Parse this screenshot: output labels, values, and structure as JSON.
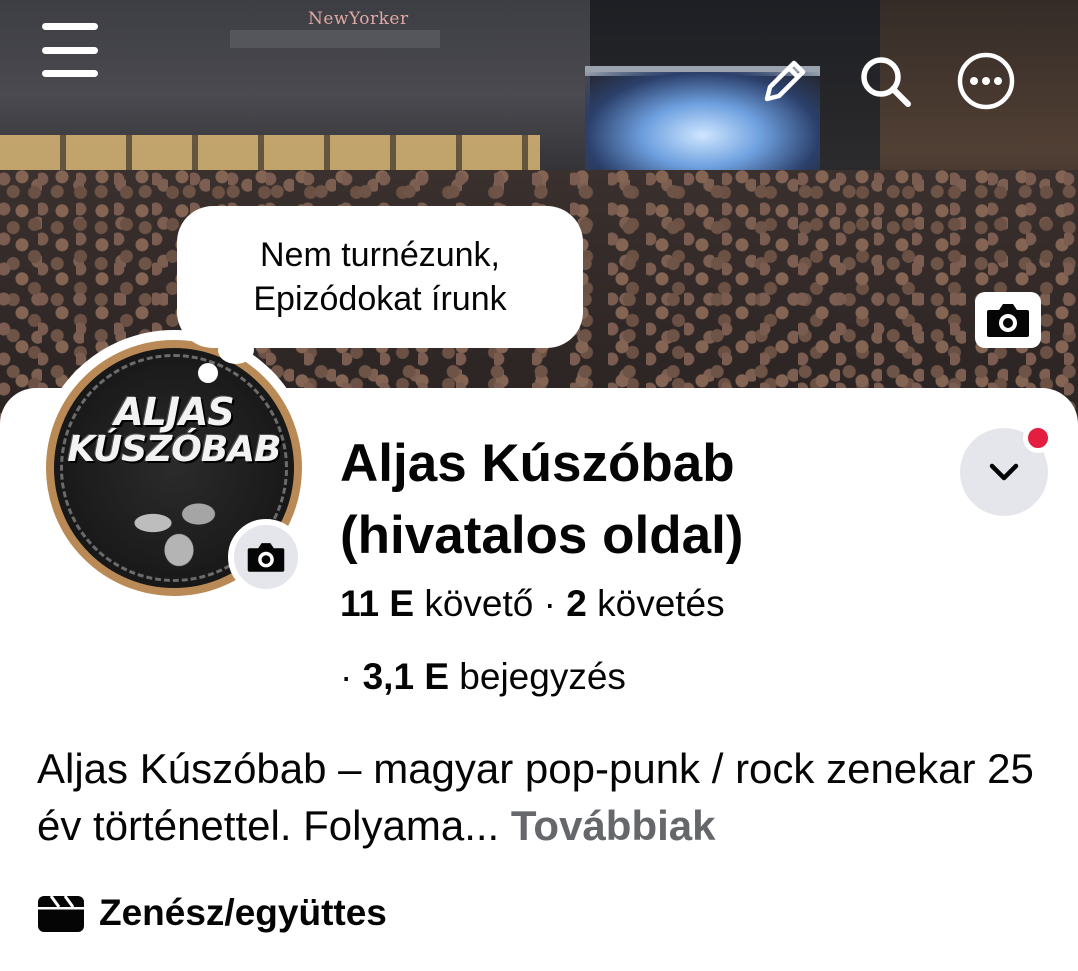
{
  "cover": {
    "sign_text": "NewYorker"
  },
  "bubble": {
    "line1": "Nem turnézunk,",
    "line2": "Epizódokat írunk"
  },
  "avatar": {
    "logo_line1": "ALJAS",
    "logo_line2": "KÚSZÓBAB"
  },
  "profile": {
    "name_line1": "Aljas Kúszóbab",
    "name_line2": "(hivatalos oldal)",
    "followers_count": "11 E",
    "followers_label": "követő",
    "separator": "·",
    "following_count": "2",
    "following_label": "követés",
    "posts_count": "3,1 E",
    "posts_label": "bejegyzés",
    "bio_text": "Aljas Kúszóbab – magyar pop-punk / rock zenekar 25 év történettel. Folyama...",
    "bio_more": "Továbbiak",
    "category": "Zenész/együttes"
  },
  "icons": {
    "menu": "menu-icon",
    "edit": "pencil-icon",
    "search": "search-icon",
    "more": "more-icon",
    "cover_camera": "camera-icon",
    "avatar_camera": "camera-icon",
    "dropdown": "chevron-down-icon",
    "category": "clapperboard-icon"
  },
  "colors": {
    "notification_dot": "#e41e3f",
    "secondary_text": "#65676b",
    "button_bg": "#e4e6eb"
  }
}
